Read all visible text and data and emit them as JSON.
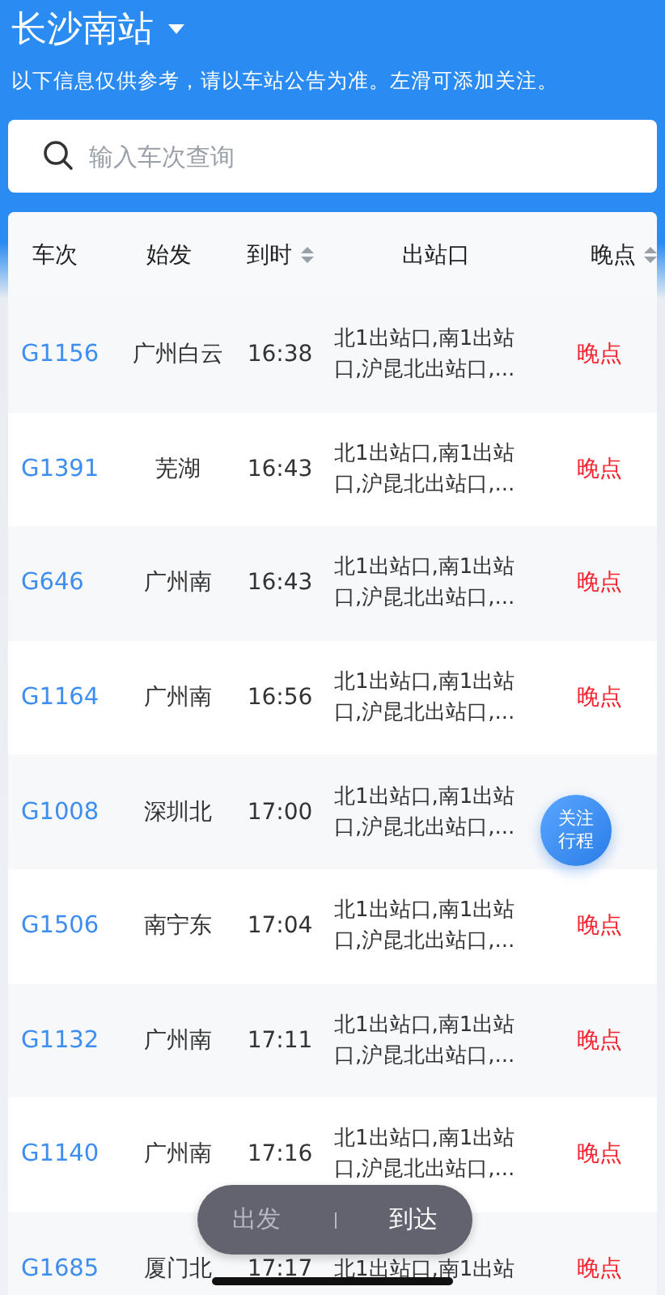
{
  "header": {
    "station": "长沙南站",
    "notice": "以下信息仅供参考，请以车站公告为准。左滑可添加关注。"
  },
  "search": {
    "placeholder": "输入车次查询"
  },
  "table": {
    "columns": [
      {
        "label": "车次",
        "sortable": false
      },
      {
        "label": "始发",
        "sortable": false
      },
      {
        "label": "到时",
        "sortable": true
      },
      {
        "label": "出站口",
        "sortable": false
      },
      {
        "label": "晚点",
        "sortable": true
      }
    ],
    "rows": [
      {
        "train": "G1156",
        "origin": "广州白云",
        "time": "16:38",
        "exit": "北1出站口,南1出站口,沪昆北出站口,...",
        "late": "晚点"
      },
      {
        "train": "G1391",
        "origin": "芜湖",
        "time": "16:43",
        "exit": "北1出站口,南1出站口,沪昆北出站口,...",
        "late": "晚点"
      },
      {
        "train": "G646",
        "origin": "广州南",
        "time": "16:43",
        "exit": "北1出站口,南1出站口,沪昆北出站口,...",
        "late": "晚点"
      },
      {
        "train": "G1164",
        "origin": "广州南",
        "time": "16:56",
        "exit": "北1出站口,南1出站口,沪昆北出站口,...",
        "late": "晚点"
      },
      {
        "train": "G1008",
        "origin": "深圳北",
        "time": "17:00",
        "exit": "北1出站口,南1出站口,沪昆北出站口,..."
      },
      {
        "train": "G1506",
        "origin": "南宁东",
        "time": "17:04",
        "exit": "北1出站口,南1出站口,沪昆北出站口,...",
        "late": "晚点"
      },
      {
        "train": "G1132",
        "origin": "广州南",
        "time": "17:11",
        "exit": "北1出站口,南1出站口,沪昆北出站口,...",
        "late": "晚点"
      },
      {
        "train": "G1140",
        "origin": "广州南",
        "time": "17:16",
        "exit": "北1出站口,南1出站口,沪昆北出站口,...",
        "late": "晚点"
      },
      {
        "train": "G1685",
        "origin": "厦门北",
        "time": "17:17",
        "exit": "北1出站口,南1出站",
        "late": "晚点"
      }
    ]
  },
  "follow_button": {
    "label": "关注行程"
  },
  "mode_toggle": [
    {
      "label": "出发",
      "selected": false
    },
    {
      "label": "到达",
      "selected": true
    }
  ]
}
